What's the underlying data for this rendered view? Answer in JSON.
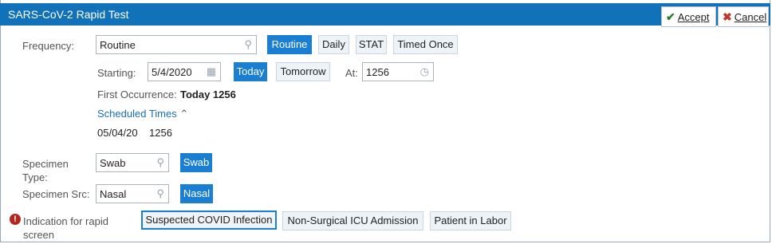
{
  "header": {
    "title": "SARS-CoV-2 Rapid Test",
    "accept_label": "Accept",
    "cancel_label": "Cancel"
  },
  "frequency": {
    "label": "Frequency:",
    "value": "Routine",
    "options": [
      "Routine",
      "Daily",
      "STAT",
      "Timed Once"
    ],
    "selected": "Routine"
  },
  "starting": {
    "label": "Starting:",
    "date": "5/4/2020",
    "today_label": "Today",
    "tomorrow_label": "Tomorrow",
    "at_label": "At:",
    "time": "1256"
  },
  "first_occurrence": {
    "label": "First Occurrence:",
    "value": "Today 1256"
  },
  "scheduled_times": {
    "label": "Scheduled Times",
    "toggle_icon": "double-chevron-up-icon",
    "date": "05/04/20",
    "time": "1256"
  },
  "specimen_type": {
    "label_line1": "Specimen",
    "label_line2": "Type:",
    "value": "Swab",
    "option": "Swab"
  },
  "specimen_src": {
    "label": "Specimen Src:",
    "value": "Nasal",
    "option": "Nasal"
  },
  "indication": {
    "label_line1": "Indication for rapid",
    "label_line2": "screen",
    "required_icon": "exclamation-circle-icon",
    "options": [
      "Suspected COVID Infection",
      "Non-Surgical ICU Admission",
      "Patient in Labor"
    ],
    "selected": "Suspected COVID Infection"
  },
  "colors": {
    "title_bar": "#1172b9",
    "selected_button": "#1a7fd2",
    "link": "#1a6fb5",
    "error": "#b3261e"
  }
}
